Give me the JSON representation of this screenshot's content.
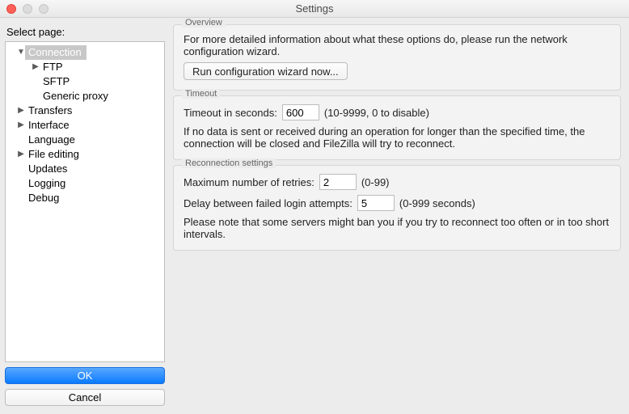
{
  "window": {
    "title": "Settings"
  },
  "sidebar": {
    "label": "Select page:",
    "items": [
      {
        "label": "Connection",
        "expanded": true,
        "depth": 0,
        "selected": true,
        "children": [
          {
            "label": "FTP",
            "expanded": false,
            "depth": 1,
            "hasChildren": true
          },
          {
            "label": "SFTP",
            "depth": 1,
            "hasChildren": false
          },
          {
            "label": "Generic proxy",
            "depth": 1,
            "hasChildren": false
          }
        ]
      },
      {
        "label": "Transfers",
        "expanded": false,
        "depth": 0,
        "hasChildren": true
      },
      {
        "label": "Interface",
        "expanded": false,
        "depth": 0,
        "hasChildren": true
      },
      {
        "label": "Language",
        "depth": 0,
        "hasChildren": false
      },
      {
        "label": "File editing",
        "expanded": false,
        "depth": 0,
        "hasChildren": true
      },
      {
        "label": "Updates",
        "depth": 0,
        "hasChildren": false
      },
      {
        "label": "Logging",
        "depth": 0,
        "hasChildren": false
      },
      {
        "label": "Debug",
        "depth": 0,
        "hasChildren": false
      }
    ],
    "ok": "OK",
    "cancel": "Cancel"
  },
  "overview": {
    "title": "Overview",
    "text": "For more detailed information about what these options do, please run the network configuration wizard.",
    "button": "Run configuration wizard now..."
  },
  "timeout": {
    "title": "Timeout",
    "label": "Timeout in seconds:",
    "value": "600",
    "hint": "(10-9999, 0 to disable)",
    "text": "If no data is sent or received during an operation for longer than the specified time, the connection will be closed and FileZilla will try to reconnect."
  },
  "reconnect": {
    "title": "Reconnection settings",
    "retries_label": "Maximum number of retries:",
    "retries_value": "2",
    "retries_hint": "(0-99)",
    "delay_label": "Delay between failed login attempts:",
    "delay_value": "5",
    "delay_hint": "(0-999 seconds)",
    "note": "Please note that some servers might ban you if you try to reconnect too often or in too short intervals."
  }
}
